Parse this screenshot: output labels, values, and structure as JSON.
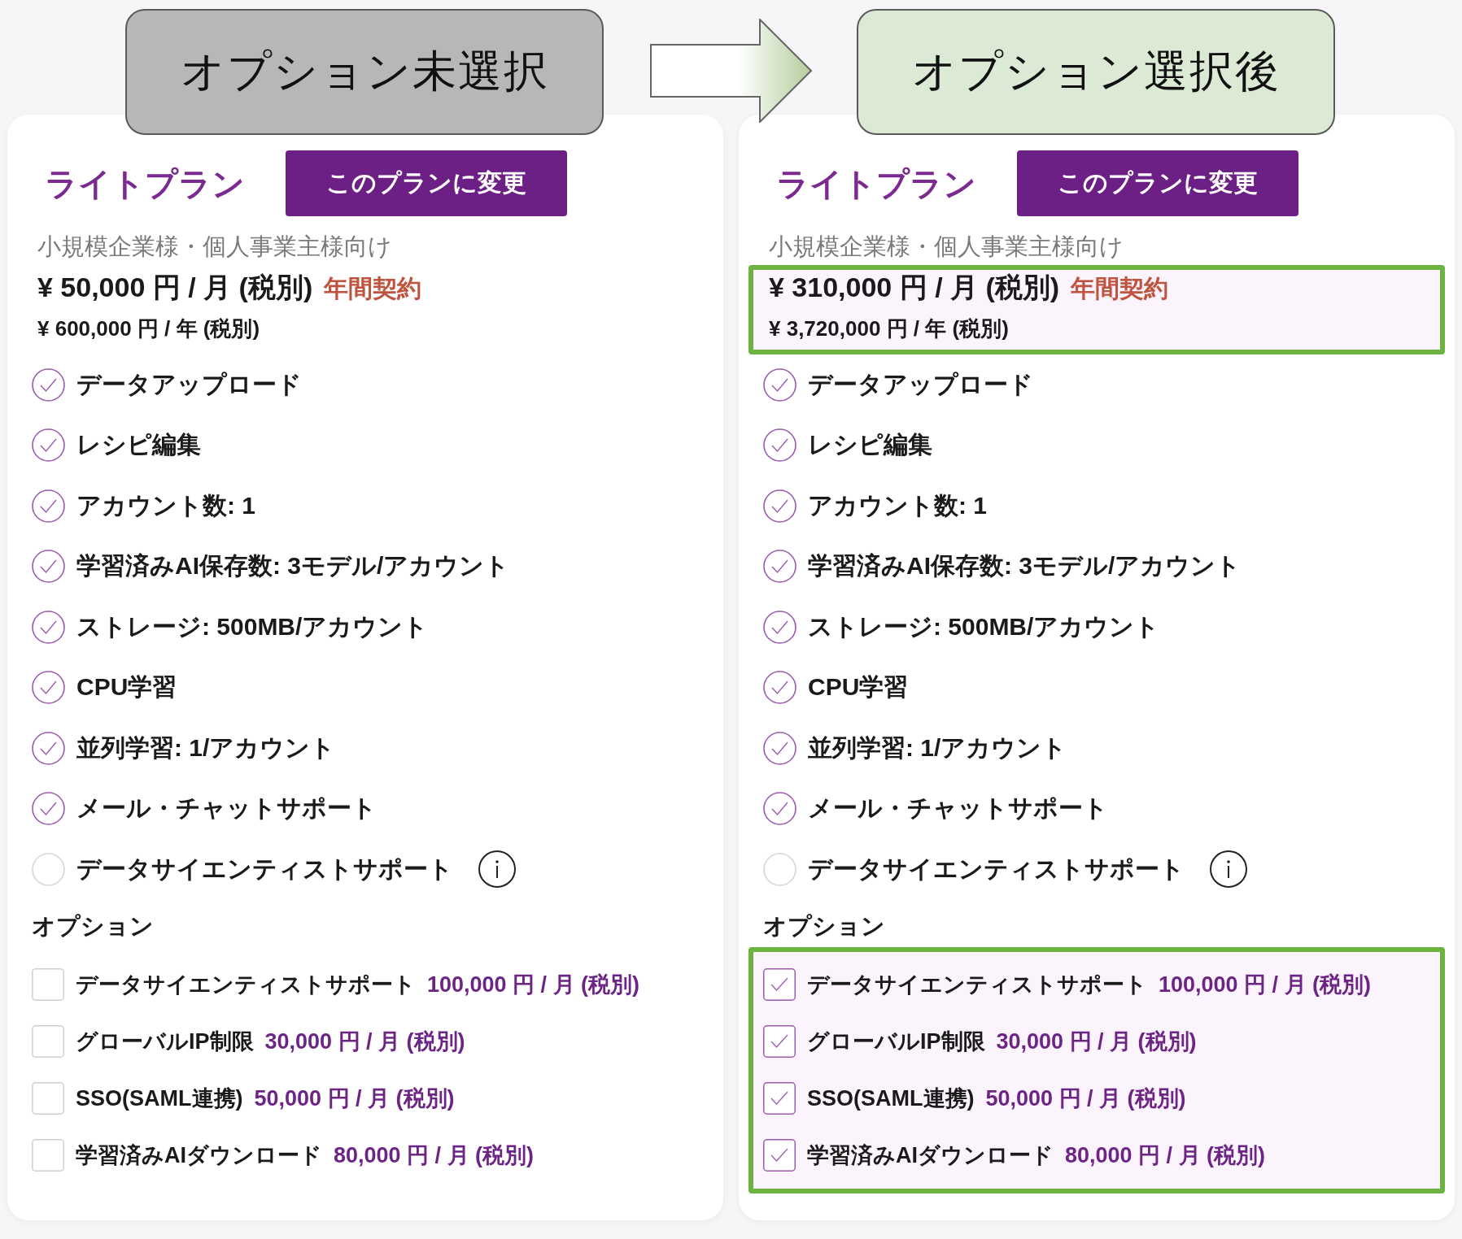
{
  "panels": [
    {
      "caption": {
        "text": "オプション未選択",
        "color": "#b7b7b7"
      },
      "plan": {
        "name": "ライトプラン",
        "change_button": "このプランに変更",
        "audience": "小規模企業様・個人事業主様向け"
      },
      "price": {
        "highlighted": false,
        "monthly": "¥ 50,000 円 / 月 (税別)",
        "contract": "年間契約",
        "yearly": "¥ 600,000 円 / 年 (税別)"
      },
      "features": [
        {
          "label": "データアップロード",
          "included": true,
          "info": false
        },
        {
          "label": "レシピ編集",
          "included": true,
          "info": false
        },
        {
          "label": "アカウント数: 1",
          "included": true,
          "info": false
        },
        {
          "label": "学習済みAI保存数: 3モデル/アカウント",
          "included": true,
          "info": false
        },
        {
          "label": "ストレージ: 500MB/アカウント",
          "included": true,
          "info": false
        },
        {
          "label": "CPU学習",
          "included": true,
          "info": false
        },
        {
          "label": "並列学習: 1/アカウント",
          "included": true,
          "info": false
        },
        {
          "label": "メール・チャットサポート",
          "included": true,
          "info": false
        },
        {
          "label": "データサイエンティストサポート",
          "included": false,
          "info": true
        }
      ],
      "options": {
        "heading": "オプション",
        "highlighted": false,
        "items": [
          {
            "label": "データサイエンティストサポート",
            "price": "100,000 円 / 月 (税別)",
            "checked": false
          },
          {
            "label": "グローバルIP制限",
            "price": "30,000 円 / 月 (税別)",
            "checked": false
          },
          {
            "label": "SSO(SAML連携)",
            "price": "50,000 円 / 月 (税別)",
            "checked": false
          },
          {
            "label": "学習済みAIダウンロード",
            "price": "80,000 円 / 月 (税別)",
            "checked": false
          }
        ]
      }
    },
    {
      "caption": {
        "text": "オプション選択後",
        "color": "#dce9d5"
      },
      "plan": {
        "name": "ライトプラン",
        "change_button": "このプランに変更",
        "audience": "小規模企業様・個人事業主様向け"
      },
      "price": {
        "highlighted": true,
        "monthly": "¥ 310,000 円 / 月 (税別)",
        "contract": "年間契約",
        "yearly": "¥ 3,720,000 円 / 年 (税別)"
      },
      "features": [
        {
          "label": "データアップロード",
          "included": true,
          "info": false
        },
        {
          "label": "レシピ編集",
          "included": true,
          "info": false
        },
        {
          "label": "アカウント数: 1",
          "included": true,
          "info": false
        },
        {
          "label": "学習済みAI保存数: 3モデル/アカウント",
          "included": true,
          "info": false
        },
        {
          "label": "ストレージ: 500MB/アカウント",
          "included": true,
          "info": false
        },
        {
          "label": "CPU学習",
          "included": true,
          "info": false
        },
        {
          "label": "並列学習: 1/アカウント",
          "included": true,
          "info": false
        },
        {
          "label": "メール・チャットサポート",
          "included": true,
          "info": false
        },
        {
          "label": "データサイエンティストサポート",
          "included": false,
          "info": true
        }
      ],
      "options": {
        "heading": "オプション",
        "highlighted": true,
        "items": [
          {
            "label": "データサイエンティストサポート",
            "price": "100,000 円 / 月 (税別)",
            "checked": true
          },
          {
            "label": "グローバルIP制限",
            "price": "30,000 円 / 月 (税別)",
            "checked": true
          },
          {
            "label": "SSO(SAML連携)",
            "price": "50,000 円 / 月 (税別)",
            "checked": true
          },
          {
            "label": "学習済みAIダウンロード",
            "price": "80,000 円 / 月 (税別)",
            "checked": true
          }
        ]
      }
    }
  ]
}
